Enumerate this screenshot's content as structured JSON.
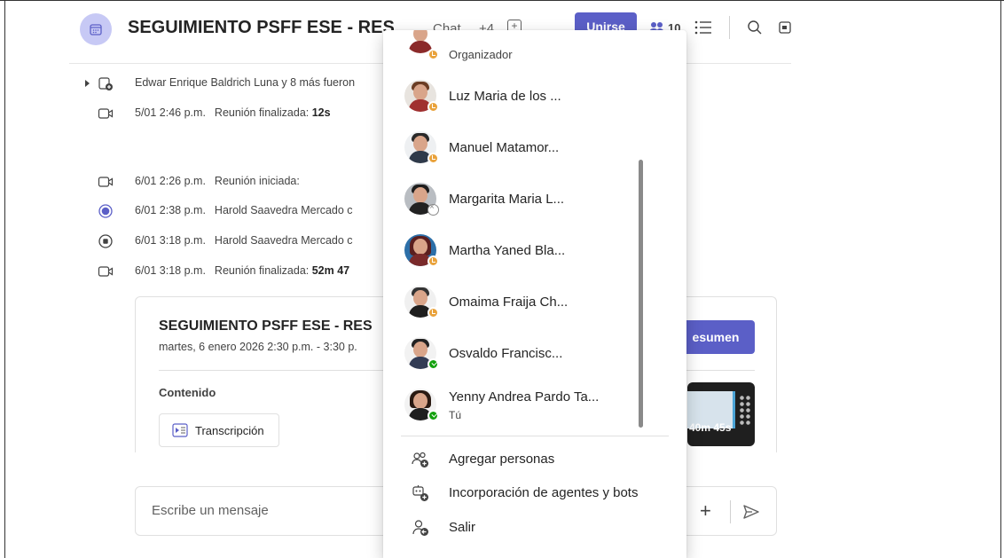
{
  "header": {
    "title": "SEGUIMIENTO PSFF ESE - RES",
    "chat_tab": "Chat",
    "extra_tabs": "+4",
    "join_label": "Unirse",
    "participants_count": "10"
  },
  "timeline": [
    {
      "icon": "participants-added-icon",
      "time": "",
      "text": "Edwar Enrique Baldrich Luna y 8 más fueron"
    },
    {
      "icon": "video-camera-icon",
      "time": "5/01 2:46 p.m.",
      "text": "Reunión finalizada:",
      "bold": "12s"
    },
    {
      "icon": "video-camera-icon",
      "time": "6/01 2:26 p.m.",
      "text": "Reunión iniciada:",
      "bold": ""
    },
    {
      "icon": "record-start-icon",
      "time": "6/01 2:38 p.m.",
      "text": "Harold Saavedra Mercado c",
      "bold": ""
    },
    {
      "icon": "record-stop-icon",
      "time": "6/01 3:18 p.m.",
      "text": "Harold Saavedra Mercado c",
      "bold": ""
    },
    {
      "icon": "video-camera-icon",
      "time": "6/01 3:18 p.m.",
      "text": "Reunión finalizada:",
      "bold": "52m 47"
    }
  ],
  "card": {
    "title": "SEGUIMIENTO PSFF ESE - RES",
    "date": "martes, 6 enero 2026 2:30 p.m. - 3:30 p.",
    "recap_button": "esumen",
    "contenido": "Contenido",
    "transcripcion": "Transcripción",
    "duration": "40m 45s"
  },
  "compose": {
    "placeholder": "Escribe un mensaje"
  },
  "flyout": {
    "top_role": "Organizador",
    "people": [
      {
        "name": "Luz Maria de los ...",
        "role": "",
        "status": "away"
      },
      {
        "name": "Manuel Matamor...",
        "role": "",
        "status": "away"
      },
      {
        "name": "Margarita Maria L...",
        "role": "",
        "status": "offline"
      },
      {
        "name": "Martha Yaned Bla...",
        "role": "",
        "status": "away"
      },
      {
        "name": "Omaima Fraija Ch...",
        "role": "",
        "status": "away"
      },
      {
        "name": "Osvaldo Francisc...",
        "role": "",
        "status": "available"
      },
      {
        "name": "Yenny Andrea Pardo Ta...",
        "role": "Tú",
        "status": "available"
      }
    ],
    "actions": [
      {
        "label": "Agregar personas",
        "icon": "add-people-icon"
      },
      {
        "label": "Incorporación de agentes y bots",
        "icon": "add-bot-icon"
      },
      {
        "label": "Salir",
        "icon": "leave-icon"
      }
    ]
  },
  "colors": {
    "accent": "#5b5fc7",
    "away": "#e9a23b",
    "available": "#13a10e"
  }
}
